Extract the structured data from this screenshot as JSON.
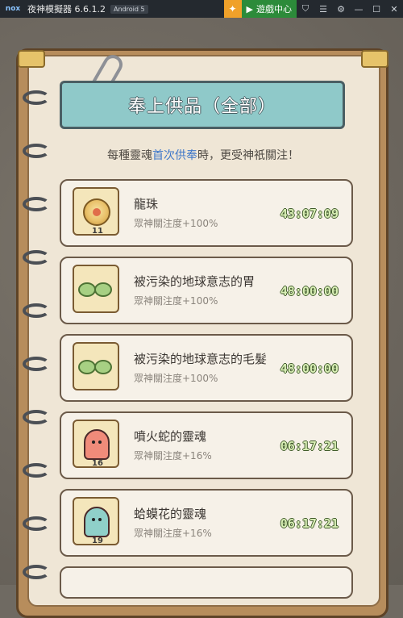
{
  "titlebar": {
    "logo": "nox",
    "title": "夜神模擬器 6.6.1.2",
    "android": "Android 5",
    "game_center": "遊戲中心",
    "icons": [
      "orange-badge-icon",
      "play-icon",
      "shirt-icon",
      "menu-icon",
      "gear-icon",
      "minimize-icon",
      "maximize-icon",
      "close-icon"
    ]
  },
  "banner": {
    "title": "奉上供品（全部）"
  },
  "subtitle": {
    "pre": "每種靈魂",
    "highlight": "首次供奉",
    "post": "時，更受神祇關注！"
  },
  "items": [
    {
      "name": "龍珠",
      "bonus": "眾神關注度+100%",
      "timer": "43:07:09",
      "count": "11",
      "icon": "dragon-pearl-icon"
    },
    {
      "name": "被污染的地球意志的胃",
      "bonus": "眾神關注度+100%",
      "timer": "48:00:00",
      "count": "",
      "icon": "green-beans-icon"
    },
    {
      "name": "被污染的地球意志的毛髮",
      "bonus": "眾神關注度+100%",
      "timer": "48:00:00",
      "count": "",
      "icon": "green-beans-icon"
    },
    {
      "name": "噴火蛇的靈魂",
      "bonus": "眾神關注度+16%",
      "timer": "06:17:21",
      "count": "16",
      "icon": "red-ghost-icon"
    },
    {
      "name": "蛤蟆花的靈魂",
      "bonus": "眾神關注度+16%",
      "timer": "06:17:21",
      "count": "19",
      "icon": "teal-ghost-icon"
    }
  ],
  "colors": {
    "banner": "#8fc9c9",
    "highlight": "#3f78c9",
    "timer": "#d9efb6",
    "red_ghost": "#f08b7a",
    "teal_ghost": "#8fd0c9"
  }
}
